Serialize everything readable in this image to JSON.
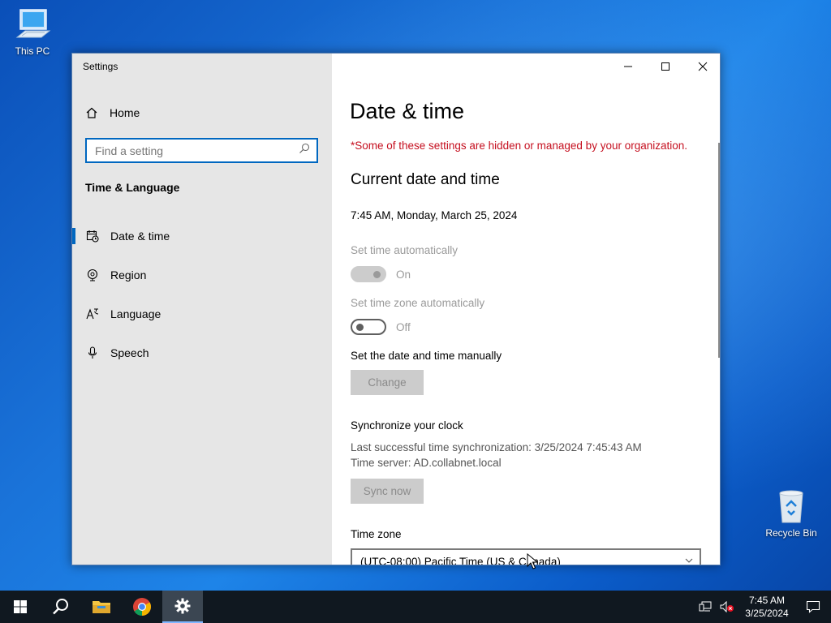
{
  "desktop": {
    "icons": [
      {
        "label": "This PC",
        "icon": "computer-icon"
      },
      {
        "label": "Recycle Bin",
        "icon": "recycle-bin-icon"
      }
    ]
  },
  "window": {
    "title": "Settings",
    "caption": {
      "minimize": "minimize-icon",
      "maximize": "maximize-icon",
      "close": "close-icon"
    }
  },
  "sidebar": {
    "home_label": "Home",
    "search_placeholder": "Find a setting",
    "section_title": "Time & Language",
    "items": [
      {
        "label": "Date & time",
        "icon": "calendar-clock-icon",
        "active": true
      },
      {
        "label": "Region",
        "icon": "globe-icon",
        "active": false
      },
      {
        "label": "Language",
        "icon": "language-icon",
        "active": false
      },
      {
        "label": "Speech",
        "icon": "microphone-icon",
        "active": false
      }
    ]
  },
  "main": {
    "title": "Date & time",
    "managed_warning": "*Some of these settings are hidden or managed by your organization.",
    "current_heading": "Current date and time",
    "current_datetime": "7:45 AM, Monday, March 25, 2024",
    "auto_time": {
      "label": "Set time automatically",
      "state": "On",
      "enabled": false
    },
    "auto_zone": {
      "label": "Set time zone automatically",
      "state": "Off",
      "enabled": true
    },
    "manual": {
      "label": "Set the date and time manually",
      "button": "Change"
    },
    "sync": {
      "heading": "Synchronize your clock",
      "last_sync": "Last successful time synchronization: 3/25/2024 7:45:43 AM",
      "server": "Time server: AD.collabnet.local",
      "button": "Sync now"
    },
    "timezone": {
      "label": "Time zone",
      "value": "(UTC-08:00) Pacific Time (US & Canada)"
    }
  },
  "taskbar": {
    "apps": [
      "start-icon",
      "search-icon",
      "file-explorer-icon",
      "chrome-icon",
      "settings-icon"
    ],
    "time": "7:45 AM",
    "date": "3/25/2024"
  }
}
